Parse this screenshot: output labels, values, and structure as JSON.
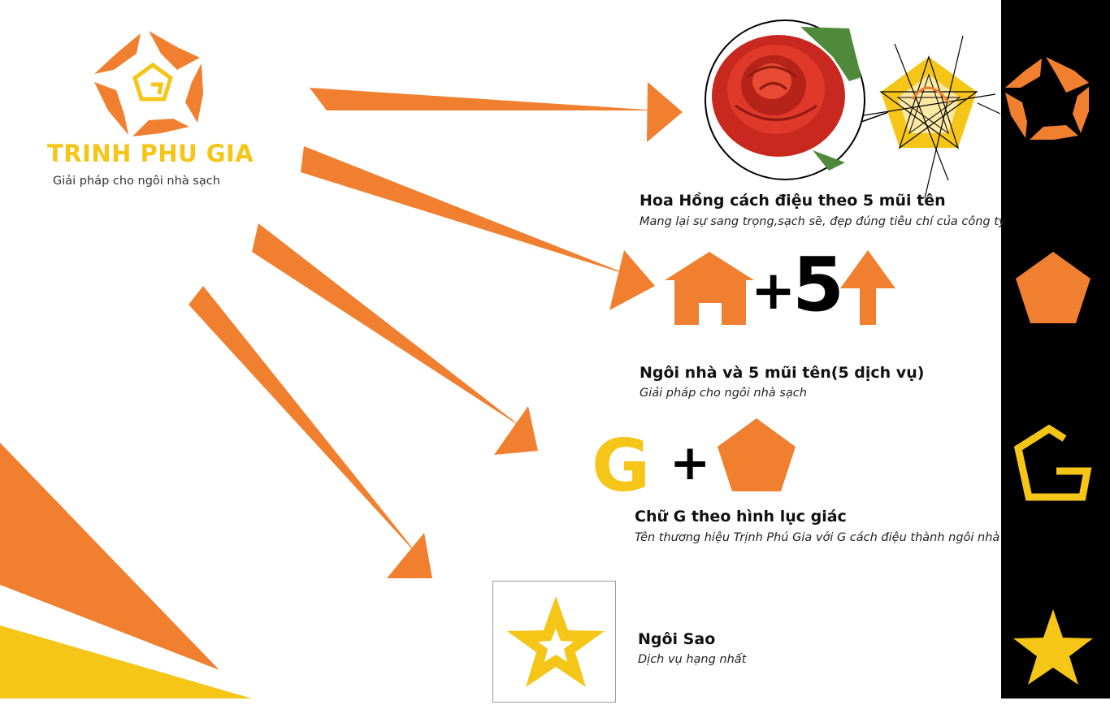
{
  "brand": {
    "name": "TRINH PHU GIA",
    "tagline": "Giải pháp cho ngôi nhà sạch"
  },
  "sections": [
    {
      "title": "Hoa Hồng cách điệu theo 5 mũi tên",
      "subtitle": "Mang lại sự sang trọng,sạch sẽ, đẹp đúng tiêu chí của công ty"
    },
    {
      "title": "Ngôi nhà và 5 mũi tên(5 dịch vụ)",
      "subtitle": "Giải pháp cho ngôi nhà sạch"
    },
    {
      "title": "Chữ G theo hình lục giác",
      "subtitle": "Tên thương hiệu Trịnh Phú Gia với G cách điệu thành ngôi nhà"
    },
    {
      "title": "Ngôi Sao",
      "subtitle": "Dịch vụ hạng nhất"
    }
  ],
  "symbols": {
    "plus": "+",
    "five": "5",
    "g": "G"
  },
  "icons": {
    "logo": "pinwheel-pentagon-logo-icon",
    "rose": "rose-photo-icon",
    "geometry": "star-geometry-icon",
    "house": "house-icon",
    "arrow_up": "arrow-up-icon",
    "pentagon": "pentagon-icon",
    "star": "star-icon"
  },
  "colors": {
    "orange": "#f08030",
    "yellow": "#f5c518",
    "black": "#000000",
    "white": "#ffffff"
  }
}
